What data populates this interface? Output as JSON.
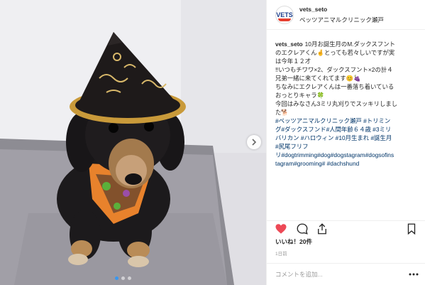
{
  "header": {
    "username": "vets_seto",
    "location": "ベッツアニマルクリニック瀬戸",
    "avatar_text": "VETS"
  },
  "caption": {
    "username": "vets_seto",
    "lines": [
      "10月お誕生月のM.ダックスフント",
      "のエクレアくん🤞とっても若々しいですが実",
      "は今年１２才",
      "‼いつもチワワ×2、ダックスフント×2の計４",
      "兄弟一緒に来てくれてます😊🍇",
      "ちなみにエクレアくんは一番落ち着いている",
      "おっとりキャラ🍀",
      "今回はみなさん3ミリ丸刈りでスッキリしまし",
      "た🐕"
    ],
    "hashtag_lines": [
      "#ベッツアニマルクリニック瀬戸 #トリミン",
      "グ#ダックスフンド#人間年齢６４歳 #3ミリ",
      "バリカン #ハロウィン #10月生まれ #誕生月",
      "#尻尾フリフ",
      "リ#dogtrimming#dog#dogstagram#dogsofins",
      "tagram#grooming# #dachshund"
    ]
  },
  "likes": "いいね！20件",
  "time": "1日前",
  "comment_placeholder": "コメントを追加...",
  "carousel": {
    "current": 1,
    "total": 3
  },
  "colors": {
    "link": "#003569",
    "heart": "#ed4956",
    "accent": "#3897f0"
  },
  "icons": [
    "heart-icon",
    "comment-icon",
    "share-icon",
    "bookmark-icon",
    "chevron-right-icon",
    "more-icon"
  ]
}
